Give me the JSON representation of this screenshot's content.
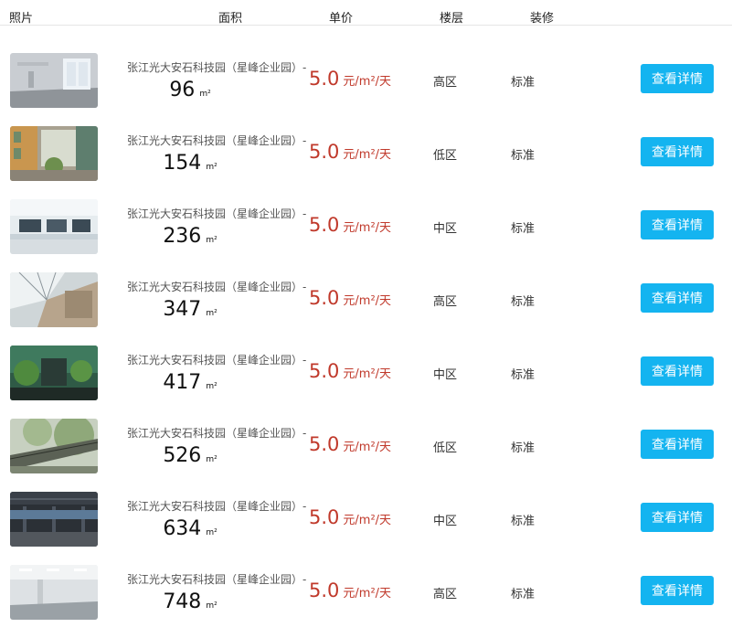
{
  "header": {
    "photo": "照片",
    "area": "面积",
    "price": "单价",
    "floor": "楼层",
    "decoration": "装修"
  },
  "listings": [
    {
      "name": "张江光大安石科技园（星峰企业园）-",
      "area": "96",
      "area_unit": "m²",
      "price": "5.0",
      "price_unit": "元/m²/天",
      "floor": "高区",
      "decoration": "标准",
      "button": "查看详情",
      "photo_scene": "office-interior-1"
    },
    {
      "name": "张江光大安石科技园（星峰企业园）-",
      "area": "154",
      "area_unit": "m²",
      "price": "5.0",
      "price_unit": "元/m²/天",
      "floor": "低区",
      "decoration": "标准",
      "button": "查看详情",
      "photo_scene": "atrium-1"
    },
    {
      "name": "张江光大安石科技园（星峰企业园）-",
      "area": "236",
      "area_unit": "m²",
      "price": "5.0",
      "price_unit": "元/m²/天",
      "floor": "中区",
      "decoration": "标准",
      "button": "查看详情",
      "photo_scene": "office-interior-2"
    },
    {
      "name": "张江光大安石科技园（星峰企业园）-",
      "area": "347",
      "area_unit": "m²",
      "price": "5.0",
      "price_unit": "元/m²/天",
      "floor": "高区",
      "decoration": "标准",
      "button": "查看详情",
      "photo_scene": "atrium-2"
    },
    {
      "name": "张江光大安石科技园（星峰企业园）-",
      "area": "417",
      "area_unit": "m²",
      "price": "5.0",
      "price_unit": "元/m²/天",
      "floor": "中区",
      "decoration": "标准",
      "button": "查看详情",
      "photo_scene": "green-building"
    },
    {
      "name": "张江光大安石科技园（星峰企业园）-",
      "area": "526",
      "area_unit": "m²",
      "price": "5.0",
      "price_unit": "元/m²/天",
      "floor": "低区",
      "decoration": "标准",
      "button": "查看详情",
      "photo_scene": "garden-walkway"
    },
    {
      "name": "张江光大安石科技园（星峰企业园）-",
      "area": "634",
      "area_unit": "m²",
      "price": "5.0",
      "price_unit": "元/m²/天",
      "floor": "中区",
      "decoration": "标准",
      "button": "查看详情",
      "photo_scene": "empty-floor-dark"
    },
    {
      "name": "张江光大安石科技园（星峰企业园）-",
      "area": "748",
      "area_unit": "m²",
      "price": "5.0",
      "price_unit": "元/m²/天",
      "floor": "高区",
      "decoration": "标准",
      "button": "查看详情",
      "photo_scene": "empty-floor-bright"
    }
  ],
  "colors": {
    "price": "#c0392b",
    "button_bg": "#14b4f0",
    "button_text": "#ffffff",
    "divider": "#e6e6e6"
  }
}
